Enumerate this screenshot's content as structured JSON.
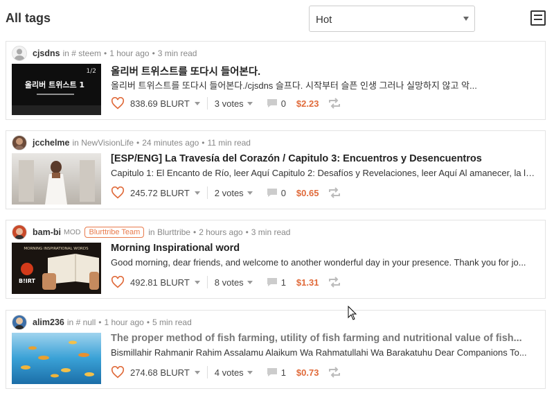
{
  "header": {
    "title": "All tags",
    "sort_value": "Hot"
  },
  "posts": [
    {
      "author": "cjsdns",
      "in_label": "in",
      "community": "# steem",
      "age": "1 hour ago",
      "read_time": "3 min read",
      "title": "올리버 트위스트를 또다시 들어본다.",
      "summary": "올리버 트위스트를 또다시 들어본다./cjsdns 슬프다. 시작부터 슬픈 인생 그러나 실망하지 않고 악...",
      "payout": "838.69 BLURT",
      "votes": "3 votes",
      "comments": "0",
      "price": "$2.23",
      "thumb_text": "올리버 트위스트 1",
      "thumb_badge": "1/2"
    },
    {
      "author": "jcchelme",
      "in_label": "in",
      "community": "NewVisionLife",
      "age": "24 minutes ago",
      "read_time": "11 min read",
      "title": "[ESP/ENG] La Travesía del Corazón / Capitulo 3: Encuentros y Desencuentros",
      "summary": "Capitulo 1: El Encanto de Río, leer Aquí Capitulo 2: Desafíos y Revelaciones, leer Aquí Al amanecer, la lu...",
      "payout": "245.72 BLURT",
      "votes": "2 votes",
      "comments": "0",
      "price": "$0.65"
    },
    {
      "author": "bam-bi",
      "mod_label": "MOD",
      "team_badge": "Blurttribe Team",
      "in_label": "in",
      "community": "Blurttribe",
      "age": "2 hours ago",
      "read_time": "3 min read",
      "title": "Morning Inspirational word",
      "summary": "Good morning, dear friends, and welcome to another wonderful day in your presence. Thank you for jo...",
      "payout": "492.81 BLURT",
      "votes": "8 votes",
      "comments": "1",
      "price": "$1.31",
      "thumb_text": "MORNING INSPIRATIONAL WORDS",
      "thumb_logo": "B!IRT"
    },
    {
      "author": "alim236",
      "in_label": "in",
      "community": "# null",
      "age": "1 hour ago",
      "read_time": "5 min read",
      "title": "The proper method of fish farming, utility of fish farming and nutritional value of fish...",
      "summary": "Bismillahir Rahmanir Rahim Assalamu Alaikum Wa Rahmatullahi Wa Barakatuhu Dear Companions To...",
      "payout": "274.68 BLURT",
      "votes": "4 votes",
      "comments": "1",
      "price": "$0.73"
    }
  ]
}
